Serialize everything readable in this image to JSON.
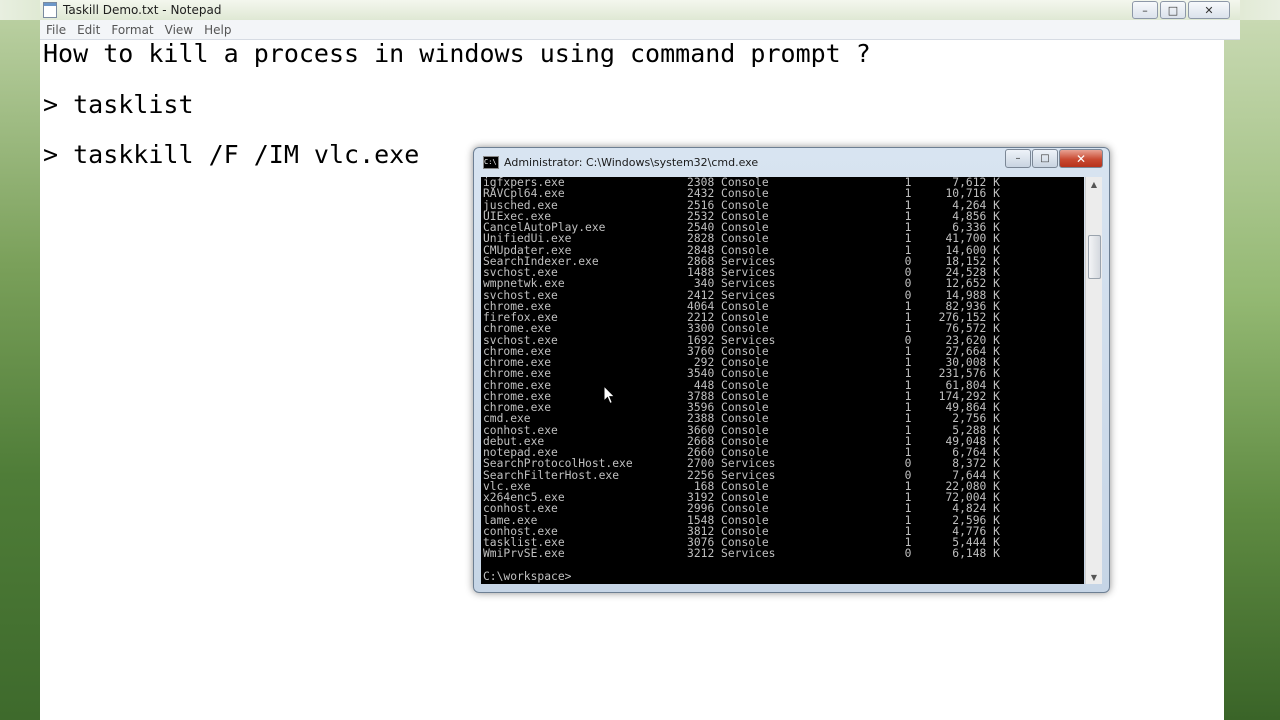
{
  "window": {
    "title": "Taskill Demo.txt - Notepad",
    "controls": {
      "minimize": "–",
      "maximize": "□",
      "close": "✕"
    }
  },
  "menu": [
    "File",
    "Edit",
    "Format",
    "View",
    "Help"
  ],
  "document": {
    "lines": [
      "How to kill a process in windows using command prompt ?",
      "> tasklist",
      "> taskkill /F /IM vlc.exe"
    ]
  },
  "cmd": {
    "title": "Administrator: C:\\Windows\\system32\\cmd.exe",
    "icon_text": "C:\\",
    "controls": {
      "minimize": "–",
      "maximize": "□",
      "close": "✕"
    },
    "rows": [
      "igfxpers.exe                  2308 Console                    1      7,612 K",
      "RAVCpl64.exe                  2432 Console                    1     10,716 K",
      "jusched.exe                   2516 Console                    1      4,264 K",
      "UIExec.exe                    2532 Console                    1      4,856 K",
      "CancelAutoPlay.exe            2540 Console                    1      6,336 K",
      "UnifiedUi.exe                 2828 Console                    1     41,700 K",
      "CMUpdater.exe                 2848 Console                    1     14,600 K",
      "SearchIndexer.exe             2868 Services                   0     18,152 K",
      "svchost.exe                   1488 Services                   0     24,528 K",
      "wmpnetwk.exe                   340 Services                   0     12,652 K",
      "svchost.exe                   2412 Services                   0     14,988 K",
      "chrome.exe                    4064 Console                    1     82,936 K",
      "firefox.exe                   2212 Console                    1    276,152 K",
      "chrome.exe                    3300 Console                    1     76,572 K",
      "svchost.exe                   1692 Services                   0     23,620 K",
      "chrome.exe                    3760 Console                    1     27,664 K",
      "chrome.exe                     292 Console                    1     30,008 K",
      "chrome.exe                    3540 Console                    1    231,576 K",
      "chrome.exe                     448 Console                    1     61,804 K",
      "chrome.exe                    3788 Console                    1    174,292 K",
      "chrome.exe                    3596 Console                    1     49,864 K",
      "cmd.exe                       2388 Console                    1      2,756 K",
      "conhost.exe                   3660 Console                    1      5,288 K",
      "debut.exe                     2668 Console                    1     49,048 K",
      "notepad.exe                   2660 Console                    1      6,764 K",
      "SearchProtocolHost.exe        2700 Services                   0      8,372 K",
      "SearchFilterHost.exe          2256 Services                   0      7,644 K",
      "vlc.exe                        168 Console                    1     22,080 K",
      "x264enc5.exe                  3192 Console                    1     72,004 K",
      "conhost.exe                   2996 Console                    1      4,824 K",
      "lame.exe                      1548 Console                    1      2,596 K",
      "conhost.exe                   3812 Console                    1      4,776 K",
      "tasklist.exe                  3076 Console                    1      5,444 K",
      "WmiPrvSE.exe                  3212 Services                   0      6,148 K",
      "",
      "C:\\workspace>"
    ]
  },
  "colors": {
    "console_bg": "#000000",
    "console_fg": "#c0c0c0",
    "close_button": "#c94a32"
  }
}
